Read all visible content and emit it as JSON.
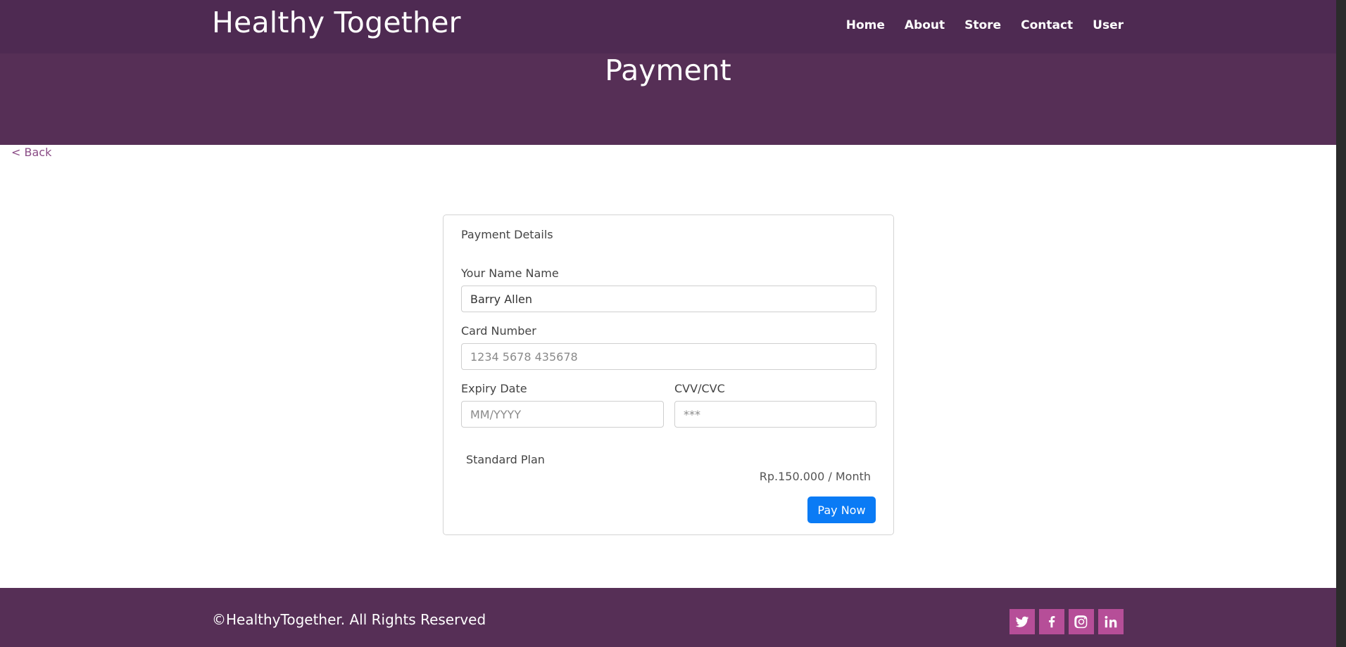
{
  "header": {
    "brand": "Healthy Together",
    "nav": [
      "Home",
      "About",
      "Store",
      "Contact",
      "User"
    ]
  },
  "hero": {
    "title": "Payment"
  },
  "back_link": "< Back",
  "payment_form": {
    "title": "Payment Details",
    "name_label": "Your Name Name",
    "name_value": "Barry Allen",
    "card_label": "Card Number",
    "card_placeholder": "1234 5678 435678",
    "expiry_label": "Expiry Date",
    "expiry_placeholder": "MM/YYYY",
    "cvv_label": "CVV/CVC",
    "cvv_placeholder": "***",
    "plan_name": "Standard Plan",
    "plan_price": "Rp.150.000 / Month",
    "pay_button": "Pay Now"
  },
  "footer": {
    "copyright": "©HealthyTogether. All Rights Reserved",
    "socials": [
      "twitter-icon",
      "facebook-icon",
      "instagram-icon",
      "linkedin-icon"
    ]
  },
  "colors": {
    "header_bg": "#4e2a52",
    "hero_bg": "#562f56",
    "accent_button": "#0a7bf5",
    "social_bg": "#b64e98",
    "back_link": "#8a4c86"
  }
}
